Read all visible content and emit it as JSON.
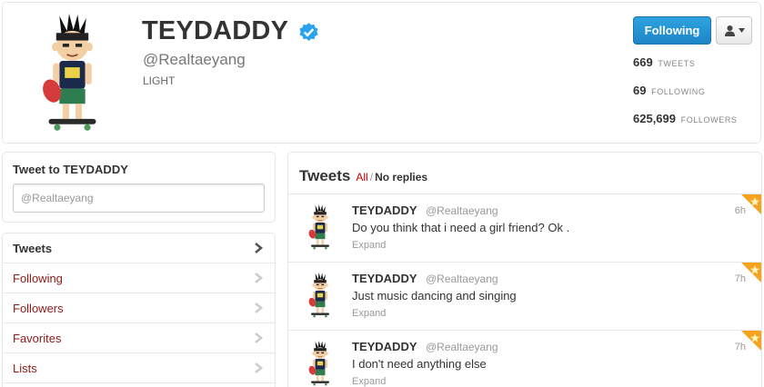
{
  "profile": {
    "name": "TEYDADDY",
    "handle": "@Realtaeyang",
    "bio": "LIGHT",
    "follow_button": "Following",
    "stats": [
      {
        "value": "669",
        "label": "TWEETS"
      },
      {
        "value": "69",
        "label": "FOLLOWING"
      },
      {
        "value": "625,699",
        "label": "FOLLOWERS"
      }
    ]
  },
  "tweet_to": {
    "title": "Tweet to TEYDADDY",
    "input_value": "@Realtaeyang"
  },
  "nav": {
    "items": [
      {
        "label": "Tweets"
      },
      {
        "label": "Following"
      },
      {
        "label": "Followers"
      },
      {
        "label": "Favorites"
      },
      {
        "label": "Lists"
      }
    ]
  },
  "stream": {
    "title": "Tweets",
    "tab_all": "All",
    "tab_sep": "/",
    "tab_noreplies": "No replies",
    "tweets": [
      {
        "name": "TEYDADDY",
        "handle": "@Realtaeyang",
        "text": "Do you think that i need a girl friend? Ok .",
        "expand": "Expand",
        "time": "6h"
      },
      {
        "name": "TEYDADDY",
        "handle": "@Realtaeyang",
        "text": "Just music dancing and singing",
        "expand": "Expand",
        "time": "7h"
      },
      {
        "name": "TEYDADDY",
        "handle": "@Realtaeyang",
        "text": "I don't need anything else",
        "expand": "Expand",
        "time": "7h"
      }
    ]
  },
  "colors": {
    "accent_blue": "#1d86c7",
    "link_red": "#8b1a1a",
    "verified": "#2aa3ef",
    "favorite_orange": "#f7a21b"
  },
  "icons": {
    "verified": "verified-badge-icon",
    "user_menu": "user-icon",
    "dropdown": "caret-down-icon",
    "chevron": "chevron-right-icon",
    "favorite": "star-icon"
  }
}
